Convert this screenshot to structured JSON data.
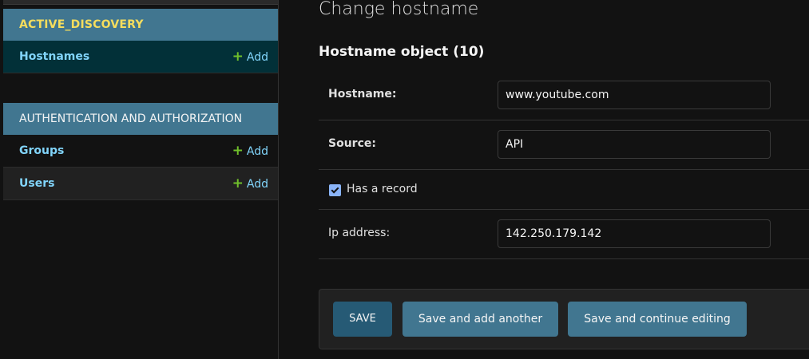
{
  "sidebar": {
    "modules": [
      {
        "caption": "ACTIVE_DISCOVERY",
        "models": [
          {
            "label": "Hostnames",
            "add": "Add"
          }
        ]
      },
      {
        "caption": "AUTHENTICATION AND AUTHORIZATION",
        "models": [
          {
            "label": "Groups",
            "add": "Add"
          },
          {
            "label": "Users",
            "add": "Add"
          }
        ]
      }
    ]
  },
  "main": {
    "page_title": "Change hostname",
    "object_title": "Hostname object (10)",
    "fields": {
      "hostname": {
        "label": "Hostname:",
        "value": "www.youtube.com"
      },
      "source": {
        "label": "Source:",
        "value": "API"
      },
      "has_a_record": {
        "label": "Has a record",
        "checked": true
      },
      "ip_address": {
        "label": "Ip address:",
        "value": "142.250.179.142"
      }
    },
    "buttons": {
      "save": "SAVE",
      "save_add_another": "Save and add another",
      "save_continue": "Save and continue editing"
    }
  },
  "colors": {
    "module_header": "#417690",
    "current_row": "#023038",
    "link": "#81d4fa",
    "add_plus": "#70bf2b",
    "save_button": "#265a75"
  }
}
